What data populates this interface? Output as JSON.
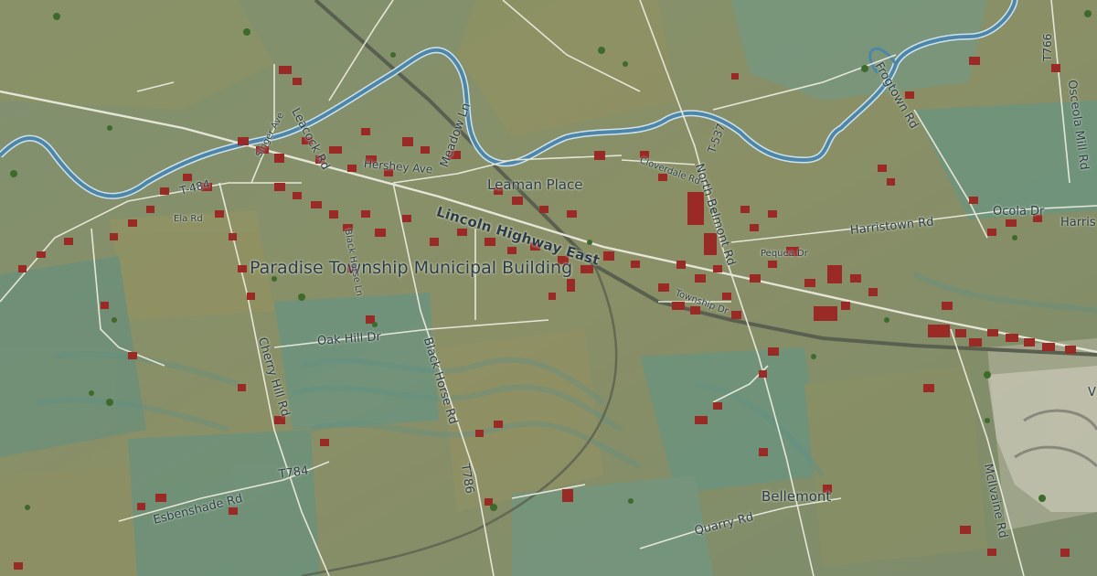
{
  "map": {
    "poi_label": "Paradise Township Municipal Building",
    "places": {
      "leaman_place": "Leaman Place",
      "bellemont": "Bellemont"
    },
    "roads": {
      "lincoln_highway_east": "Lincoln Highway East",
      "hershey_ave": "Hershey Ave",
      "meadow_ln": "Meadow Ln",
      "leacock_rd": "Leacock Rd",
      "singer_ave": "Singer Ave",
      "t484": "T-484",
      "ela_rd": "Ela Rd",
      "oak_hill_dr": "Oak Hill Dr",
      "cherry_hill_rd": "Cherry Hill Rd",
      "black_horse_rd": "Black Horse Rd",
      "t786": "T786",
      "t784": "T784",
      "esbenshade_rd": "Esbenshade Rd",
      "quarry_rd": "Quarry Rd",
      "north_belmont_rd": "North Belmont Rd",
      "t537": "T-537",
      "frogtown_rd": "Frogtown Rd",
      "t766": "T766",
      "osceola_mill_rd": "Osceola Mill Rd",
      "harristown_rd": "Harristown Rd",
      "harristown_rd_east": "Harris",
      "ocola_dr": "Ocola Dr",
      "township_dr": "Township Dr",
      "pequea_dr": "Pequea Dr",
      "cloverdale_rd": "Cloverdale Rd",
      "mcilvaine_rd": "McIlvaine Rd",
      "edge_letter": "V",
      "black_horse_ln": "Black Horse Ln"
    },
    "colors": {
      "terrain_green": "#6f8a62",
      "field_tan": "#8c8d5f",
      "field_teal": "#5f9487",
      "river": "#4d86a8",
      "building": "#9a2a25",
      "road": "#e6e6d8",
      "railroad": "#5a6050",
      "label": "#2b3a46"
    }
  }
}
